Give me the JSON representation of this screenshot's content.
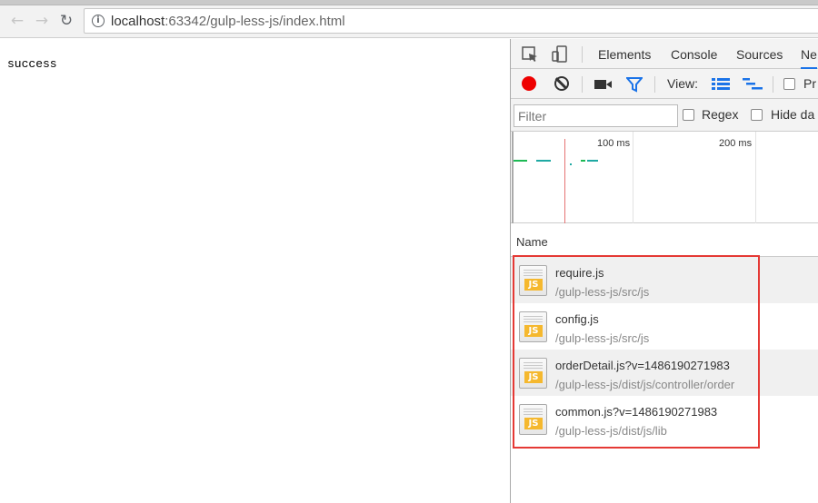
{
  "browser": {
    "url_host": "localhost",
    "url_rest": ":63342/gulp-less-js/index.html",
    "back_icon": "back-arrow-icon",
    "forward_icon": "forward-arrow-icon",
    "reload_icon": "reload-icon",
    "info_icon": "info-icon"
  },
  "page": {
    "text": "success"
  },
  "devtools": {
    "tabs": [
      "Elements",
      "Console",
      "Sources",
      "Ne"
    ],
    "active_tab": "Ne",
    "toolbar": {
      "view_label": "View:",
      "preserve_label": "Pr",
      "record_color": "#ee0000"
    },
    "filter": {
      "placeholder": "Filter",
      "regex_label": "Regex",
      "hide_label": "Hide da"
    },
    "timeline": {
      "ticks": [
        "100 ms",
        "200 ms"
      ]
    },
    "name_header": "Name",
    "requests": [
      {
        "name": "require.js",
        "path": "/gulp-less-js/src/js"
      },
      {
        "name": "config.js",
        "path": "/gulp-less-js/src/js"
      },
      {
        "name": "orderDetail.js?v=1486190271983",
        "path": "/gulp-less-js/dist/js/controller/order"
      },
      {
        "name": "common.js?v=1486190271983",
        "path": "/gulp-less-js/dist/js/lib"
      }
    ]
  },
  "colors": {
    "highlight_box": "#e53935",
    "timeline_green": "#1db954",
    "timeline_teal": "#1fa9a3"
  }
}
